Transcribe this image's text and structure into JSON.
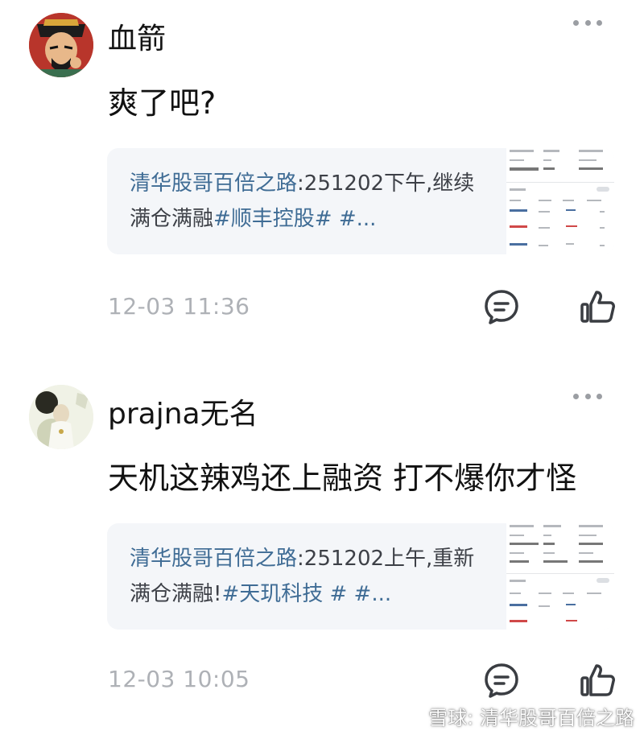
{
  "posts": [
    {
      "username": "血箭",
      "comment": "爽了吧?",
      "card": {
        "author": "清华股哥百倍之路",
        "separator": ":",
        "text": "251202下午,继续满仓满融",
        "tags": "#顺丰控股# #..."
      },
      "timestamp": "12-03 11:36",
      "icons": {
        "avatar": "avatar-ancient-official",
        "reply": "comment-icon",
        "like": "thumbs-up-icon",
        "more": "more-icon"
      }
    },
    {
      "username": "prajna无名",
      "comment": "天机这辣鸡还上融资 打不爆你才怪",
      "card": {
        "author": "清华股哥百倍之路",
        "separator": ":",
        "text": "251202上午,重新满仓满融!",
        "tags": "#天玑科技 # #..."
      },
      "timestamp": "12-03 10:05",
      "icons": {
        "avatar": "avatar-figure-photo",
        "reply": "comment-icon",
        "like": "thumbs-up-icon",
        "more": "more-icon"
      }
    }
  ],
  "watermark": {
    "text": "雪球: 清华股哥百倍之路"
  },
  "colors": {
    "link": "#3f6c95",
    "muted": "#aeb1b6",
    "card_bg": "#f4f6f9",
    "icon": "#3a3d42"
  }
}
